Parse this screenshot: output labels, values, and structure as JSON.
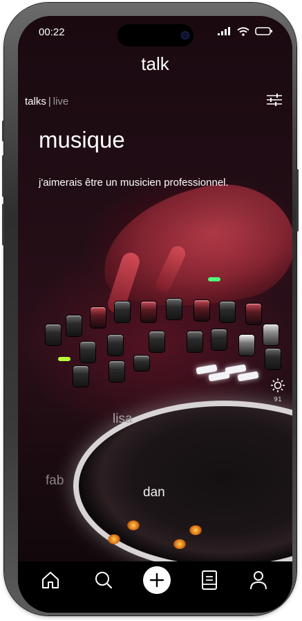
{
  "status_bar": {
    "time": "00:22"
  },
  "app": {
    "title": "talk"
  },
  "tabs": {
    "talks": "talks",
    "separator": "|",
    "live": "live"
  },
  "topic": {
    "title": "musique",
    "quote": "j'aimerais être un musicien professionnel."
  },
  "brightness": {
    "value": "91"
  },
  "participants": [
    "lisa",
    "fab",
    "dan"
  ],
  "icons": {
    "filter": "sliders-icon",
    "brightness": "sun-icon",
    "home": "home-icon",
    "search": "search-icon",
    "add": "plus-icon",
    "docs": "document-icon",
    "profile": "user-icon"
  },
  "colors": {
    "accent": "#ffffff",
    "tabbar": "#000000"
  }
}
